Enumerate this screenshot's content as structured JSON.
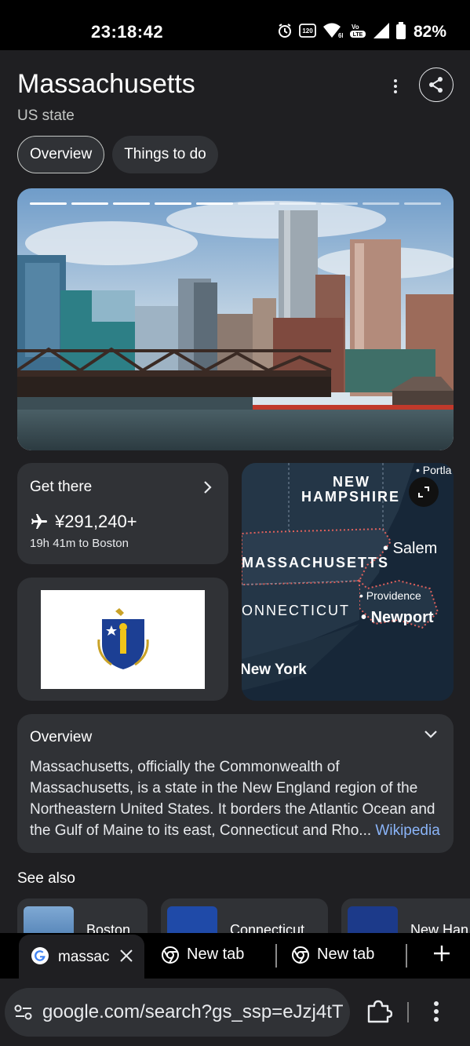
{
  "status_bar": {
    "time": "23:18:42",
    "battery": "82%",
    "icons": [
      "alarm-icon",
      "refresh-rate-icon",
      "wifi-6e-icon",
      "volte-icon",
      "signal-icon",
      "battery-icon"
    ]
  },
  "header": {
    "title": "Massachusetts",
    "subtitle": "US state",
    "chips": [
      {
        "label": "Overview",
        "active": true
      },
      {
        "label": "Things to do",
        "active": false
      }
    ]
  },
  "hero": {
    "image": "boston-skyline-photo",
    "total_slides": 10,
    "current_slide": 5
  },
  "get_there": {
    "label": "Get there",
    "price": "¥291,240+",
    "duration": "19h 41m to Boston"
  },
  "flag": {
    "image": "massachusetts-flag"
  },
  "map": {
    "labels": {
      "state_main": "MASSACHUSETTS",
      "state_nh_line1": "NEW",
      "state_nh_line2": "HAMPSHIRE",
      "state_ct": "ONNECTICUT",
      "state_ny": "New York",
      "city_salem": "Salem",
      "city_newport": "Newport",
      "city_providence": "Providence",
      "city_portland": "Portla"
    }
  },
  "overview": {
    "heading": "Overview",
    "text": "Massachusetts, officially the Commonwealth of Massachusetts, is a state in the New England region of the Northeastern United States. It borders the Atlantic Ocean and the Gulf of Maine to its east, Connecticut and Rho",
    "ellipsis": "...",
    "source": "Wikipedia"
  },
  "see_also": {
    "heading": "See also",
    "items": [
      "Boston",
      "Connecticut",
      "New Han"
    ]
  },
  "tabs": [
    {
      "title": "massac",
      "active": true
    },
    {
      "title": "New tab",
      "active": false
    },
    {
      "title": "New tab",
      "active": false
    }
  ],
  "omnibox": {
    "url": "google.com/search?gs_ssp=eJzj4tT"
  },
  "colors": {
    "background": "#1f1f22",
    "card": "#303236",
    "link": "#8ab4f8",
    "status_bar": "#000000"
  }
}
